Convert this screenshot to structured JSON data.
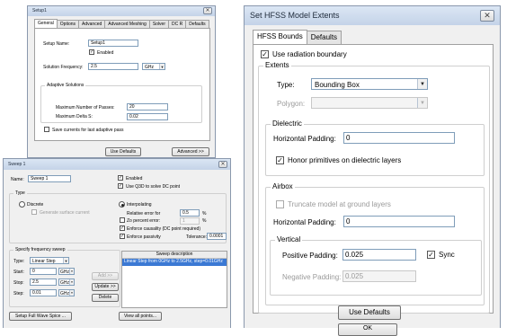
{
  "setup": {
    "title": "Setup1",
    "tabs": [
      "General",
      "Options",
      "Advanced",
      "Advanced Meshing",
      "Solver",
      "DC R",
      "Defaults"
    ],
    "setup_name_label": "Setup Name:",
    "setup_name": "Setup1",
    "enabled_label": "Enabled",
    "freq_label": "Solution Frequency:",
    "freq_value": "2.5",
    "freq_unit": "GHz",
    "adaptive_group": "Adaptive Solutions",
    "passes_label": "Maximum Number of Passes:",
    "passes_value": "20",
    "delta_label": "Maximum Delta S:",
    "delta_value": "0.02",
    "save_currents_label": "Save currents for last adaptive pass",
    "use_defaults": "Use Defaults",
    "advanced": "Advanced >>"
  },
  "sweep": {
    "title": "Sweep 1",
    "name_label": "Name:",
    "name_value": "Sweep 1",
    "enabled_label": "Enabled",
    "q3d_label": "Use Q3D to solve DC point",
    "type_group": "Type",
    "discrete_label": "Discrete",
    "gen_surface_label": "Generate surface current",
    "interp_label": "Interpolating",
    "rel_err_label": "Relative error for",
    "rel_err_value": "0.5",
    "rel_err_unit": "%",
    "zo_label": "Zo percent error:",
    "zo_value": "1",
    "zo_unit": "%",
    "causality_label": "Enforce causality (DC point required)",
    "passivity_label": "Enforce passivity",
    "tol_label": "Tolerance:",
    "tol_value": "0.0001",
    "freq_group": "Specify frequency sweep",
    "type_label": "Type:",
    "type_value": "Linear Step",
    "start_label": "Start:",
    "start_value": "0",
    "stop_label": "Stop:",
    "stop_value": "2.5",
    "step_label": "Step:",
    "step_value": "0.01",
    "unit": "GHz",
    "add_btn": "Add >>",
    "update_btn": "Update >>",
    "delete_btn": "Delete",
    "desc_header": "Sweep description",
    "desc_row": "Linear Step from 0GHz to 2.5GHz, step=0.01GHz",
    "full_wave_btn": "Setup Full Wave Spice ...",
    "view_points_btn": "View all points..."
  },
  "extents": {
    "title": "Set HFSS Model Extents",
    "tabs": [
      "HFSS Bounds",
      "Defaults"
    ],
    "radiation_label": "Use radiation boundary",
    "extents_group": "Extents",
    "type_label": "Type:",
    "type_value": "Bounding Box",
    "polygon_label": "Polygon:",
    "dielectric_group": "Dielectric",
    "hpad_label": "Horizontal Padding:",
    "dielectric_hpad": "0",
    "honor_label": "Honor primitives on dielectric layers",
    "airbox_group": "Airbox",
    "truncate_label": "Truncate model at ground layers",
    "airbox_hpad": "0",
    "vertical_group": "Vertical",
    "pos_pad_label": "Positive Padding:",
    "pos_pad_value": "0.025",
    "sync_label": "Sync",
    "neg_pad_label": "Negative Padding:",
    "neg_pad_value": "0.025",
    "use_defaults": "Use Defaults",
    "ok_partial": "OK"
  }
}
